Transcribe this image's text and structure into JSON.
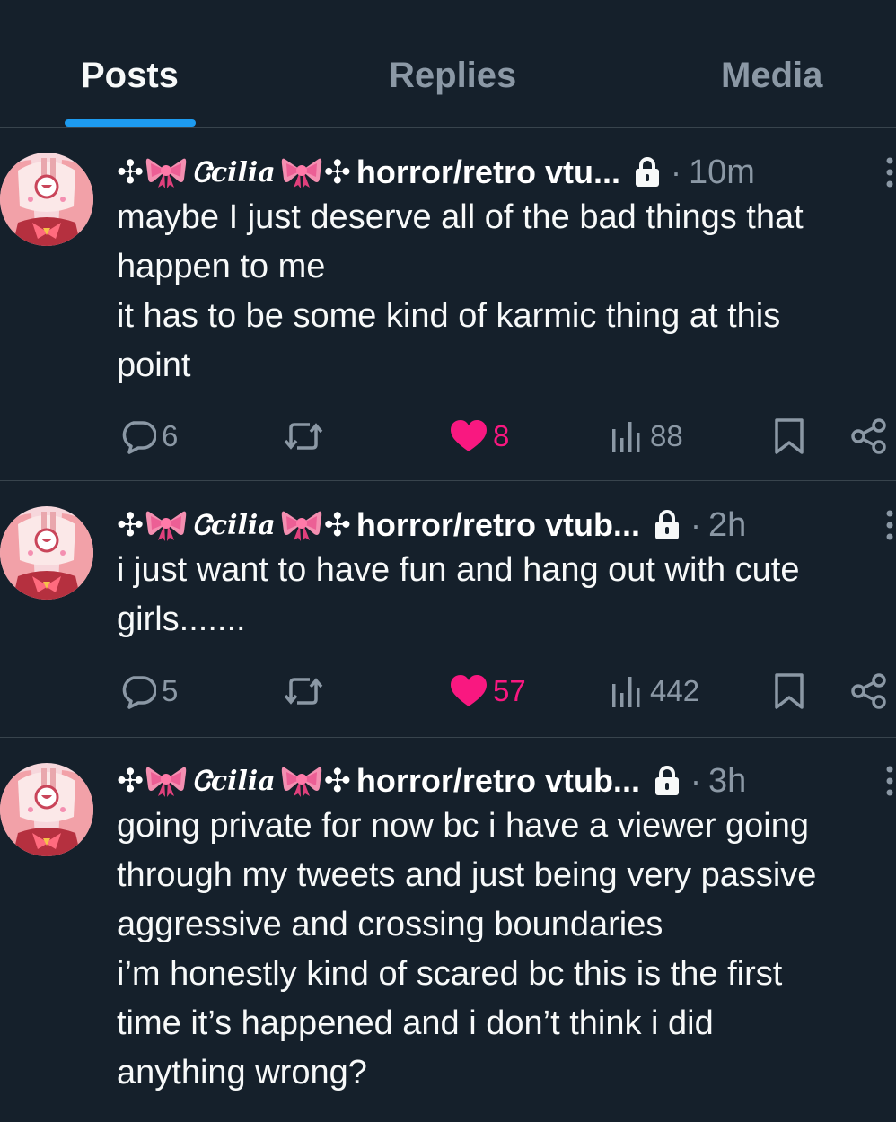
{
  "tabs": [
    {
      "label": "Posts",
      "active": true
    },
    {
      "label": "Replies",
      "active": false
    },
    {
      "label": "Media",
      "active": false
    }
  ],
  "colors": {
    "background": "#15202b",
    "accent": "#1d9bf0",
    "like": "#f91880",
    "muted": "#8b98a5",
    "text": "#f7f9f9"
  },
  "posts": [
    {
      "author": {
        "deco_left": "✣",
        "script_name": "Ꮳcilia",
        "deco_right": "✣",
        "name_rest": "horror/retro vtu...",
        "icons": [
          "ribbon-bow-icon",
          "ribbon-bow-icon",
          "lock-icon"
        ]
      },
      "separator": "·",
      "time": "10m",
      "text_lines": [
        "maybe I just deserve all of the bad things that",
        "happen to me",
        "it has to be some kind of karmic thing at this",
        "point"
      ],
      "stats": {
        "replies": "6",
        "reposts": "",
        "likes": "8",
        "views": "88",
        "liked": true
      }
    },
    {
      "author": {
        "deco_left": "✣",
        "script_name": "Ꮳcilia",
        "deco_right": "✣",
        "name_rest": "horror/retro vtub...",
        "icons": [
          "ribbon-bow-icon",
          "ribbon-bow-icon",
          "lock-icon"
        ]
      },
      "separator": "·",
      "time": "2h",
      "text_lines": [
        "i just want to have fun and hang out with cute",
        "girls......."
      ],
      "stats": {
        "replies": "5",
        "reposts": "",
        "likes": "57",
        "views": "442",
        "liked": true
      }
    },
    {
      "author": {
        "deco_left": "✣",
        "script_name": "Ꮳcilia",
        "deco_right": "✣",
        "name_rest": "horror/retro vtub...",
        "icons": [
          "ribbon-bow-icon",
          "ribbon-bow-icon",
          "lock-icon"
        ]
      },
      "separator": "·",
      "time": "3h",
      "text_lines": [
        "going private for now bc i have a viewer going",
        "through my tweets and just being very passive",
        "aggressive and crossing boundaries",
        "i’m honestly kind of scared bc this is the first",
        "time it’s happened and i don’t think i did",
        "anything wrong?"
      ],
      "stats": null
    }
  ]
}
